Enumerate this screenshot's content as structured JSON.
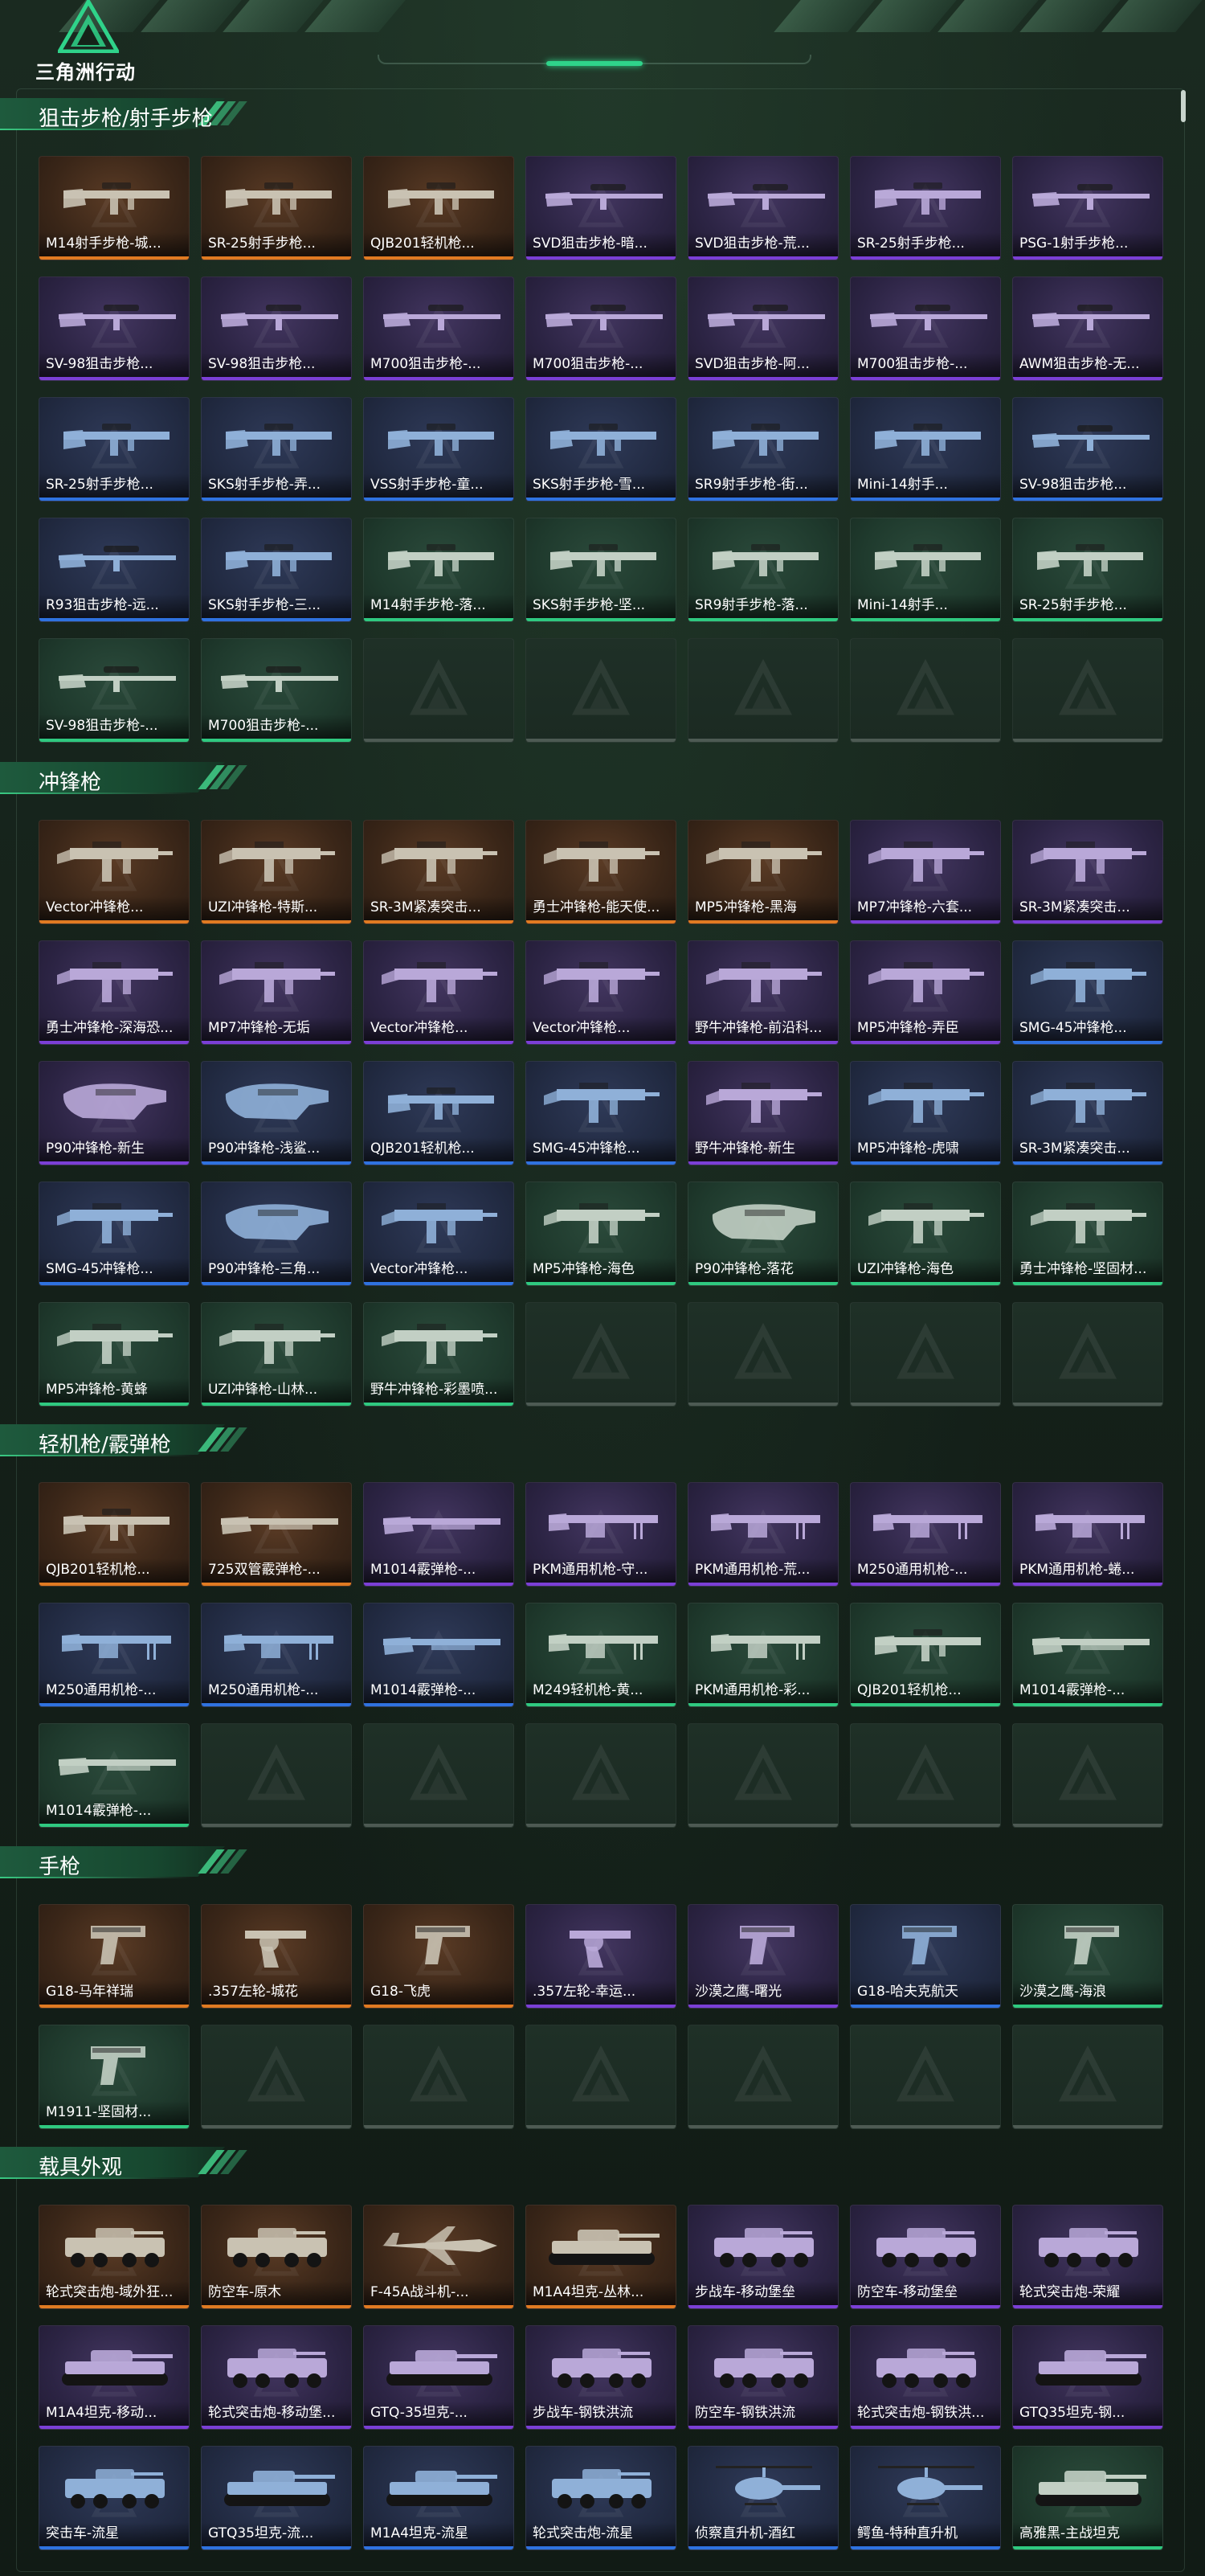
{
  "header": {
    "logo_text": "三角洲行动"
  },
  "colors": {
    "gold": "#e07a22",
    "purple": "#7b3fd6",
    "blue": "#2f72e0",
    "green": "#2fc980",
    "accent": "#2fd38a"
  },
  "sections": [
    {
      "title": "狙击步枪/射手步枪",
      "items": [
        {
          "name": "M14射手步枪-城...",
          "rarity": "gold",
          "kind": "rifle"
        },
        {
          "name": "SR-25射手步枪...",
          "rarity": "gold",
          "kind": "rifle"
        },
        {
          "name": "QJB201轻机枪...",
          "rarity": "gold",
          "kind": "rifle"
        },
        {
          "name": "SVD狙击步枪-暗...",
          "rarity": "purple",
          "kind": "sniper"
        },
        {
          "name": "SVD狙击步枪-荒...",
          "rarity": "purple",
          "kind": "sniper"
        },
        {
          "name": "SR-25射手步枪...",
          "rarity": "purple",
          "kind": "rifle"
        },
        {
          "name": "PSG-1射手步枪...",
          "rarity": "purple",
          "kind": "sniper"
        },
        {
          "name": "SV-98狙击步枪...",
          "rarity": "purple",
          "kind": "sniper"
        },
        {
          "name": "SV-98狙击步枪...",
          "rarity": "purple",
          "kind": "sniper"
        },
        {
          "name": "M700狙击步枪-...",
          "rarity": "purple",
          "kind": "sniper"
        },
        {
          "name": "M700狙击步枪-...",
          "rarity": "purple",
          "kind": "sniper"
        },
        {
          "name": "SVD狙击步枪-阿...",
          "rarity": "purple",
          "kind": "sniper"
        },
        {
          "name": "M700狙击步枪-...",
          "rarity": "purple",
          "kind": "sniper"
        },
        {
          "name": "AWM狙击步枪-无...",
          "rarity": "purple",
          "kind": "sniper"
        },
        {
          "name": "SR-25射手步枪...",
          "rarity": "blue",
          "kind": "rifle"
        },
        {
          "name": "SKS射手步枪-弄...",
          "rarity": "blue",
          "kind": "rifle"
        },
        {
          "name": "VSS射手步枪-童...",
          "rarity": "blue",
          "kind": "rifle"
        },
        {
          "name": "SKS射手步枪-雪...",
          "rarity": "blue",
          "kind": "rifle"
        },
        {
          "name": "SR9射手步枪-街...",
          "rarity": "blue",
          "kind": "rifle"
        },
        {
          "name": "Mini-14射手...",
          "rarity": "blue",
          "kind": "rifle"
        },
        {
          "name": "SV-98狙击步枪...",
          "rarity": "blue",
          "kind": "sniper"
        },
        {
          "name": "R93狙击步枪-远...",
          "rarity": "blue",
          "kind": "sniper"
        },
        {
          "name": "SKS射手步枪-三...",
          "rarity": "blue",
          "kind": "rifle"
        },
        {
          "name": "M14射手步枪-落...",
          "rarity": "green",
          "kind": "rifle"
        },
        {
          "name": "SKS射手步枪-坚...",
          "rarity": "green",
          "kind": "rifle"
        },
        {
          "name": "SR9射手步枪-落...",
          "rarity": "green",
          "kind": "rifle"
        },
        {
          "name": "Mini-14射手...",
          "rarity": "green",
          "kind": "rifle"
        },
        {
          "name": "SR-25射手步枪...",
          "rarity": "green",
          "kind": "rifle"
        },
        {
          "name": "SV-98狙击步枪-...",
          "rarity": "green",
          "kind": "sniper"
        },
        {
          "name": "M700狙击步枪-...",
          "rarity": "green",
          "kind": "sniper"
        }
      ],
      "empty_slots": 5
    },
    {
      "title": "冲锋枪",
      "items": [
        {
          "name": "Vector冲锋枪...",
          "rarity": "gold",
          "kind": "smg"
        },
        {
          "name": "UZI冲锋枪-特斯...",
          "rarity": "gold",
          "kind": "smg"
        },
        {
          "name": "SR-3M紧凑突击...",
          "rarity": "gold",
          "kind": "smg"
        },
        {
          "name": "勇士冲锋枪-能天使...",
          "rarity": "gold",
          "kind": "smg"
        },
        {
          "name": "MP5冲锋枪-黑海",
          "rarity": "gold",
          "kind": "smg"
        },
        {
          "name": "MP7冲锋枪-六套...",
          "rarity": "purple",
          "kind": "smg"
        },
        {
          "name": "SR-3M紧凑突击...",
          "rarity": "purple",
          "kind": "smg"
        },
        {
          "name": "勇士冲锋枪-深海恐...",
          "rarity": "purple",
          "kind": "smg"
        },
        {
          "name": "MP7冲锋枪-无垢",
          "rarity": "purple",
          "kind": "smg"
        },
        {
          "name": "Vector冲锋枪...",
          "rarity": "purple",
          "kind": "smg"
        },
        {
          "name": "Vector冲锋枪...",
          "rarity": "purple",
          "kind": "smg"
        },
        {
          "name": "野牛冲锋枪-前沿科...",
          "rarity": "purple",
          "kind": "smg"
        },
        {
          "name": "MP5冲锋枪-弄臣",
          "rarity": "purple",
          "kind": "smg"
        },
        {
          "name": "SMG-45冲锋枪...",
          "rarity": "blue",
          "kind": "smg"
        },
        {
          "name": "P90冲锋枪-新生",
          "rarity": "purple",
          "kind": "p90"
        },
        {
          "name": "P90冲锋枪-浅鲨...",
          "rarity": "blue",
          "kind": "p90"
        },
        {
          "name": "QJB201轻机枪...",
          "rarity": "blue",
          "kind": "rifle"
        },
        {
          "name": "SMG-45冲锋枪...",
          "rarity": "blue",
          "kind": "smg"
        },
        {
          "name": "野牛冲锋枪-新生",
          "rarity": "purple",
          "kind": "smg"
        },
        {
          "name": "MP5冲锋枪-虎啸",
          "rarity": "blue",
          "kind": "smg"
        },
        {
          "name": "SR-3M紧凑突击...",
          "rarity": "blue",
          "kind": "smg"
        },
        {
          "name": "SMG-45冲锋枪...",
          "rarity": "blue",
          "kind": "smg"
        },
        {
          "name": "P90冲锋枪-三角...",
          "rarity": "blue",
          "kind": "p90"
        },
        {
          "name": "Vector冲锋枪...",
          "rarity": "blue",
          "kind": "smg"
        },
        {
          "name": "MP5冲锋枪-海色",
          "rarity": "green",
          "kind": "smg"
        },
        {
          "name": "P90冲锋枪-落花",
          "rarity": "green",
          "kind": "p90"
        },
        {
          "name": "UZI冲锋枪-海色",
          "rarity": "green",
          "kind": "smg"
        },
        {
          "name": "勇士冲锋枪-坚固材...",
          "rarity": "green",
          "kind": "smg"
        },
        {
          "name": "MP5冲锋枪-黄蜂",
          "rarity": "green",
          "kind": "smg"
        },
        {
          "name": "UZI冲锋枪-山林...",
          "rarity": "green",
          "kind": "smg"
        },
        {
          "name": "野牛冲锋枪-彩墨喷...",
          "rarity": "green",
          "kind": "smg"
        }
      ],
      "empty_slots": 4
    },
    {
      "title": "轻机枪/霰弹枪",
      "items": [
        {
          "name": "QJB201轻机枪...",
          "rarity": "gold",
          "kind": "rifle"
        },
        {
          "name": "725双管霰弹枪-...",
          "rarity": "gold",
          "kind": "shotgun"
        },
        {
          "name": "M1014霰弹枪-...",
          "rarity": "purple",
          "kind": "shotgun"
        },
        {
          "name": "PKM通用机枪-守...",
          "rarity": "purple",
          "kind": "lmg"
        },
        {
          "name": "PKM通用机枪-荒...",
          "rarity": "purple",
          "kind": "lmg"
        },
        {
          "name": "M250通用机枪-...",
          "rarity": "purple",
          "kind": "lmg"
        },
        {
          "name": "PKM通用机枪-蜷...",
          "rarity": "purple",
          "kind": "lmg"
        },
        {
          "name": "M250通用机枪-...",
          "rarity": "blue",
          "kind": "lmg"
        },
        {
          "name": "M250通用机枪-...",
          "rarity": "blue",
          "kind": "lmg"
        },
        {
          "name": "M1014霰弹枪-...",
          "rarity": "blue",
          "kind": "shotgun"
        },
        {
          "name": "M249轻机枪-黄...",
          "rarity": "green",
          "kind": "lmg"
        },
        {
          "name": "PKM通用机枪-彩...",
          "rarity": "green",
          "kind": "lmg"
        },
        {
          "name": "QJB201轻机枪...",
          "rarity": "green",
          "kind": "rifle"
        },
        {
          "name": "M1014霰弹枪-...",
          "rarity": "green",
          "kind": "shotgun"
        },
        {
          "name": "M1014霰弹枪-...",
          "rarity": "green",
          "kind": "shotgun"
        }
      ],
      "empty_slots": 6
    },
    {
      "title": "手枪",
      "items": [
        {
          "name": "G18-马年祥瑞",
          "rarity": "gold",
          "kind": "pistol"
        },
        {
          "name": ".357左轮-城花",
          "rarity": "gold",
          "kind": "revolver"
        },
        {
          "name": "G18-飞虎",
          "rarity": "gold",
          "kind": "pistol"
        },
        {
          "name": ".357左轮-幸运...",
          "rarity": "purple",
          "kind": "revolver"
        },
        {
          "name": "沙漠之鹰-曙光",
          "rarity": "purple",
          "kind": "pistol"
        },
        {
          "name": "G18-哈夫克航天",
          "rarity": "blue",
          "kind": "pistol"
        },
        {
          "name": "沙漠之鹰-海浪",
          "rarity": "green",
          "kind": "pistol"
        },
        {
          "name": "M1911-坚固材...",
          "rarity": "green",
          "kind": "pistol"
        }
      ],
      "empty_slots": 6
    },
    {
      "title": "载具外观",
      "items": [
        {
          "name": "轮式突击炮-域外狂...",
          "rarity": "gold",
          "kind": "vehicle"
        },
        {
          "name": "防空车-原木",
          "rarity": "gold",
          "kind": "vehicle"
        },
        {
          "name": "F-45A战斗机-...",
          "rarity": "gold",
          "kind": "jet"
        },
        {
          "name": "M1A4坦克-丛林...",
          "rarity": "gold",
          "kind": "tank"
        },
        {
          "name": "步战车-移动堡垒",
          "rarity": "purple",
          "kind": "vehicle"
        },
        {
          "name": "防空车-移动堡垒",
          "rarity": "purple",
          "kind": "vehicle"
        },
        {
          "name": "轮式突击炮-荣耀",
          "rarity": "purple",
          "kind": "vehicle"
        },
        {
          "name": "M1A4坦克-移动...",
          "rarity": "purple",
          "kind": "tank"
        },
        {
          "name": "轮式突击炮-移动堡...",
          "rarity": "purple",
          "kind": "vehicle"
        },
        {
          "name": "GTQ-35坦克-...",
          "rarity": "purple",
          "kind": "tank"
        },
        {
          "name": "步战车-钢铁洪流",
          "rarity": "purple",
          "kind": "vehicle"
        },
        {
          "name": "防空车-钢铁洪流",
          "rarity": "purple",
          "kind": "vehicle"
        },
        {
          "name": "轮式突击炮-钢铁洪...",
          "rarity": "purple",
          "kind": "vehicle"
        },
        {
          "name": "GTQ35坦克-钢...",
          "rarity": "purple",
          "kind": "tank"
        },
        {
          "name": "突击车-流星",
          "rarity": "blue",
          "kind": "vehicle"
        },
        {
          "name": "GTQ35坦克-流...",
          "rarity": "blue",
          "kind": "tank"
        },
        {
          "name": "M1A4坦克-流星",
          "rarity": "blue",
          "kind": "tank"
        },
        {
          "name": "轮式突击炮-流星",
          "rarity": "blue",
          "kind": "vehicle"
        },
        {
          "name": "侦察直升机-酒红",
          "rarity": "blue",
          "kind": "heli"
        },
        {
          "name": "鳄鱼-特种直升机",
          "rarity": "blue",
          "kind": "heli"
        },
        {
          "name": "高雅黑-主战坦克",
          "rarity": "green",
          "kind": "tank"
        }
      ],
      "empty_slots": 0
    }
  ]
}
